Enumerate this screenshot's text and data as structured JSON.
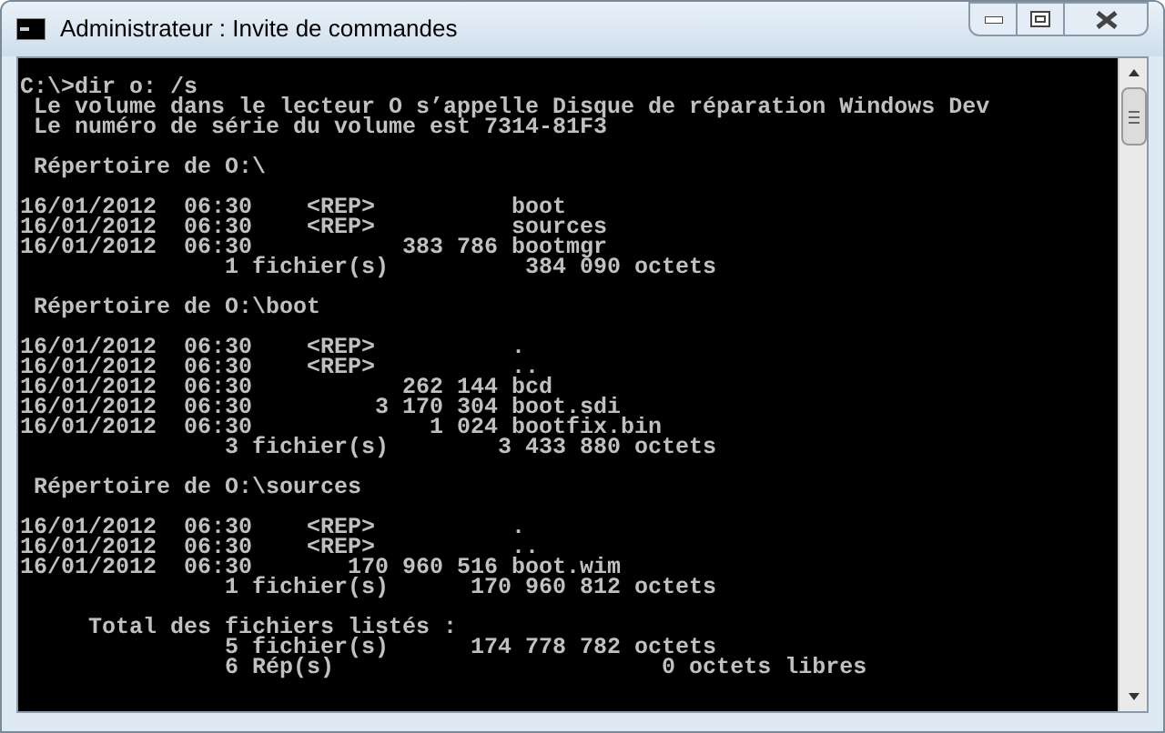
{
  "window": {
    "title": "Administrateur : Invite de commandes"
  },
  "console": {
    "blocks": [
      [
        "C:\\>dir o: /s",
        " Le volume dans le lecteur O s’appelle Disque de réparation Windows Dev",
        " Le numéro de série du volume est 7314-81F3"
      ],
      [
        " Répertoire de O:\\"
      ],
      [
        "16/01/2012  06:30    <REP>          boot",
        "16/01/2012  06:30    <REP>          sources",
        "16/01/2012  06:30           383 786 bootmgr",
        "               1 fichier(s)          384 090 octets"
      ],
      [
        " Répertoire de O:\\boot"
      ],
      [
        "16/01/2012  06:30    <REP>          .",
        "16/01/2012  06:30    <REP>          ..",
        "16/01/2012  06:30           262 144 bcd",
        "16/01/2012  06:30         3 170 304 boot.sdi",
        "16/01/2012  06:30             1 024 bootfix.bin",
        "               3 fichier(s)        3 433 880 octets"
      ],
      [
        " Répertoire de O:\\sources"
      ],
      [
        "16/01/2012  06:30    <REP>          .",
        "16/01/2012  06:30    <REP>          ..",
        "16/01/2012  06:30       170 960 516 boot.wim",
        "               1 fichier(s)      170 960 812 octets"
      ],
      [
        "     Total des fichiers listés :",
        "               5 fichier(s)      174 778 782 octets",
        "               6 Rép(s)                        0 octets libres"
      ]
    ]
  }
}
